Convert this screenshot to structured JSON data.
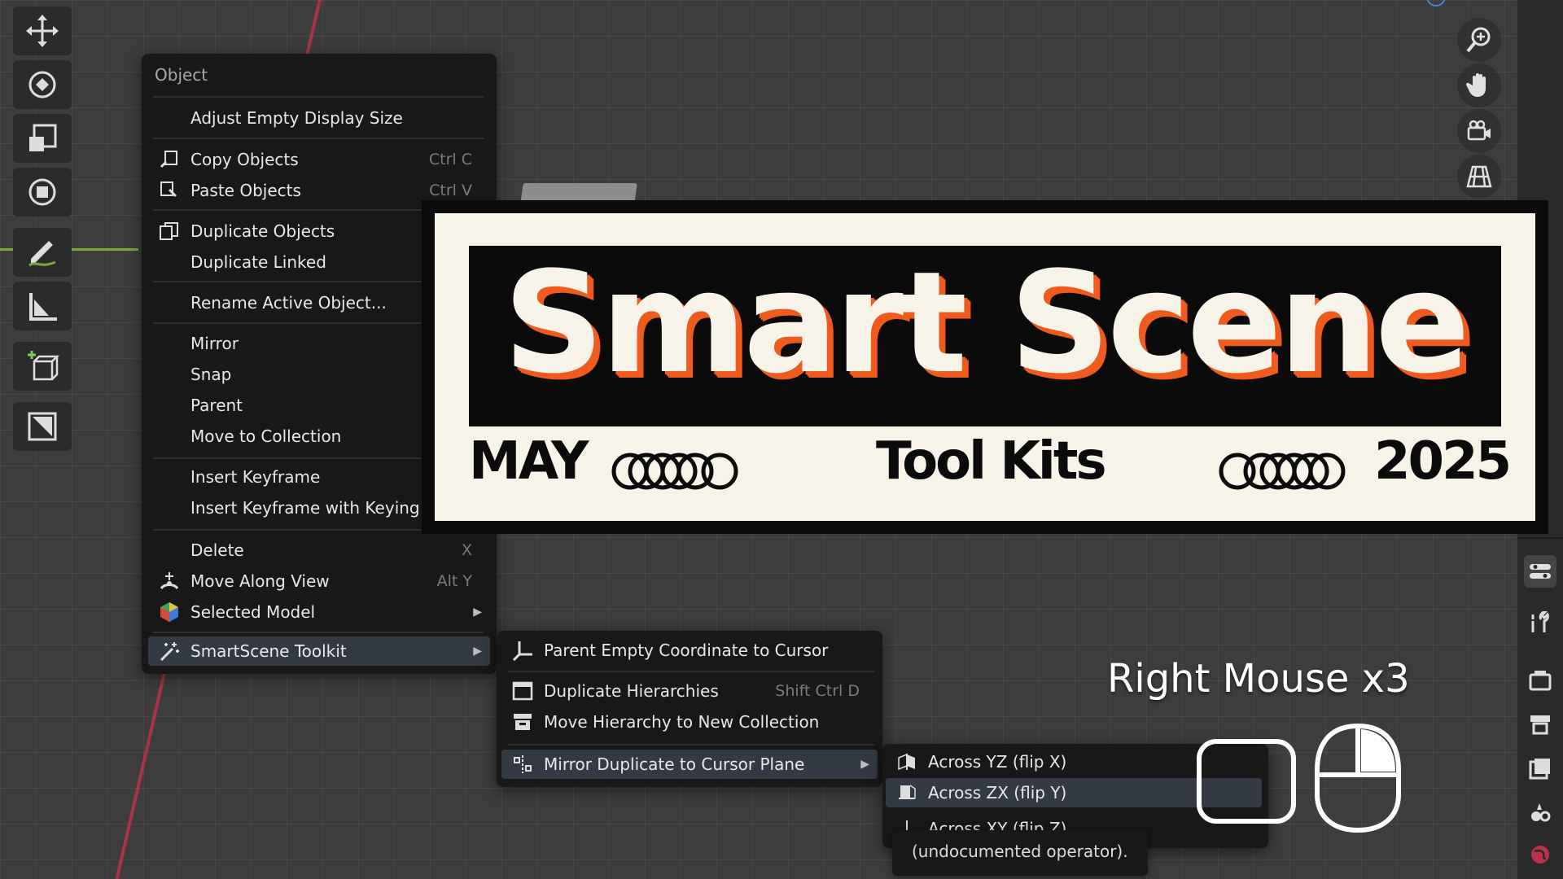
{
  "context_menu": {
    "title": "Object",
    "items": [
      {
        "label": "Adjust Empty Display Size",
        "shortcut": "",
        "icon": ""
      },
      {
        "label": "Copy Objects",
        "shortcut": "Ctrl C",
        "icon": "copy-icon"
      },
      {
        "label": "Paste Objects",
        "shortcut": "Ctrl V",
        "icon": "paste-icon"
      },
      {
        "label": "Duplicate Objects",
        "shortcut": "",
        "icon": "duplicate-icon"
      },
      {
        "label": "Duplicate Linked",
        "shortcut": "",
        "icon": ""
      },
      {
        "label": "Rename Active Object...",
        "shortcut": "",
        "icon": ""
      },
      {
        "label": "Mirror",
        "shortcut": "",
        "icon": ""
      },
      {
        "label": "Snap",
        "shortcut": "",
        "icon": ""
      },
      {
        "label": "Parent",
        "shortcut": "",
        "icon": ""
      },
      {
        "label": "Move to Collection",
        "shortcut": "",
        "icon": ""
      },
      {
        "label": "Insert Keyframe",
        "shortcut": "",
        "icon": ""
      },
      {
        "label": "Insert Keyframe with Keying",
        "shortcut": "",
        "icon": ""
      },
      {
        "label": "Delete",
        "shortcut": "X",
        "icon": ""
      },
      {
        "label": "Move Along View",
        "shortcut": "Alt Y",
        "icon": "move-view-icon"
      },
      {
        "label": "Selected Model",
        "shortcut": "",
        "icon": "hexagon-color-icon",
        "submenu": true
      },
      {
        "label": "SmartScene Toolkit",
        "shortcut": "",
        "icon": "wand-icon",
        "submenu": true,
        "highlighted": true
      }
    ]
  },
  "submenu": {
    "items": [
      {
        "label": "Parent Empty Coordinate to Cursor",
        "shortcut": "",
        "icon": "empty-axes-icon"
      },
      {
        "label": "Duplicate Hierarchies",
        "shortcut": "Shift Ctrl D",
        "icon": "window-icon"
      },
      {
        "label": "Move Hierarchy to New Collection",
        "shortcut": "",
        "icon": "collection-box-icon"
      },
      {
        "label": "Mirror Duplicate to Cursor Plane",
        "shortcut": "",
        "icon": "mirror-cursor-icon",
        "submenu": true,
        "highlighted": true
      }
    ]
  },
  "submenu2": {
    "items": [
      {
        "label": "Across YZ (flip X)",
        "icon": "flip-x-icon"
      },
      {
        "label": "Across ZX (flip Y)",
        "icon": "flip-y-icon",
        "highlighted": true
      },
      {
        "label": "Across XY (flip Z)",
        "icon": "flip-z-icon"
      }
    ]
  },
  "tooltip": {
    "text": "(undocumented operator)."
  },
  "banner": {
    "title": "Smart Scene",
    "left_text": "MAY",
    "center_text": "Tool Kits",
    "right_text": "2025",
    "colors": {
      "accent": "#ef5b1e",
      "cream": "#f7f3e8",
      "black": "#0b0b0b"
    }
  },
  "overlay": {
    "shortcut_text": "Right Mouse x3"
  },
  "toolbar": {
    "tools": [
      "move-icon",
      "rotate-icon",
      "scale-icon",
      "transform-icon",
      "annotate-icon",
      "measure-icon",
      "add-cube-icon",
      "image-icon"
    ]
  },
  "nav": {
    "buttons": [
      "zoom-icon",
      "hand-pan-icon",
      "camera-icon",
      "grid-perspective-icon"
    ]
  },
  "properties": {
    "buttons": [
      "tool-settings-icon",
      "wrench-icon",
      "render-icon",
      "output-icon",
      "view-layer-icon",
      "scene-icon",
      "world-icon"
    ]
  }
}
